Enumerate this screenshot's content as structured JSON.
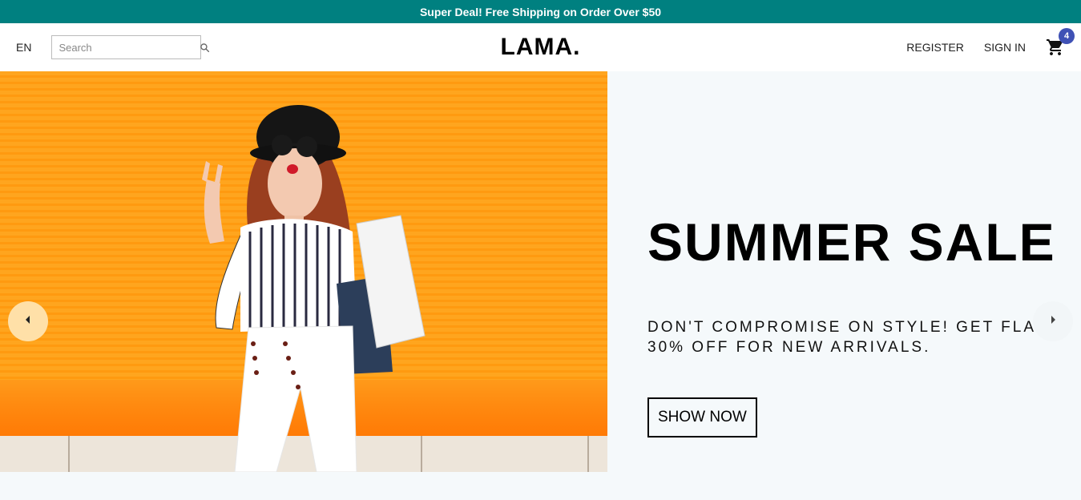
{
  "announcement": "Super Deal! Free Shipping on Order Over $50",
  "nav": {
    "lang": "EN",
    "search_placeholder": "Search",
    "logo": "LAMA.",
    "register": "REGISTER",
    "sign_in": "SIGN IN",
    "cart_count": "4"
  },
  "slide": {
    "title": "SUMMER SALE",
    "description": "DON'T COMPROMISE ON STYLE! GET FLAT 30% OFF FOR NEW ARRIVALS.",
    "button": "SHOW NOW"
  },
  "colors": {
    "announcement_bg": "#008080",
    "badge_bg": "#3f51b5",
    "hero_bg": "#ffa51e",
    "info_bg": "#f5f9fb"
  },
  "icons": {
    "search": "search-icon",
    "cart": "shopping-cart-icon",
    "left_arrow": "arrow-left-icon",
    "right_arrow": "arrow-right-icon"
  }
}
